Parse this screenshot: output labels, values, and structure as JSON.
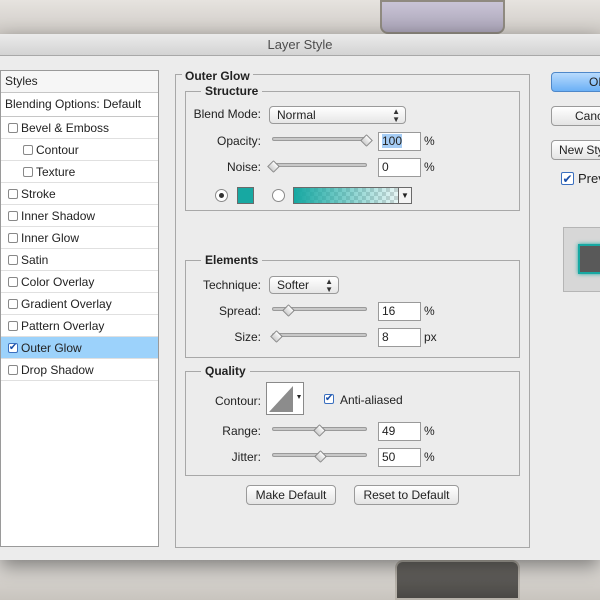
{
  "window": {
    "title": "Layer Style"
  },
  "styles_panel": {
    "header": "Styles",
    "blending_options": "Blending Options: Default",
    "items": [
      {
        "label": "Bevel & Emboss",
        "checked": false,
        "sub": false
      },
      {
        "label": "Contour",
        "checked": false,
        "sub": true
      },
      {
        "label": "Texture",
        "checked": false,
        "sub": true
      },
      {
        "label": "Stroke",
        "checked": false,
        "sub": false
      },
      {
        "label": "Inner Shadow",
        "checked": false,
        "sub": false
      },
      {
        "label": "Inner Glow",
        "checked": false,
        "sub": false
      },
      {
        "label": "Satin",
        "checked": false,
        "sub": false
      },
      {
        "label": "Color Overlay",
        "checked": false,
        "sub": false
      },
      {
        "label": "Gradient Overlay",
        "checked": false,
        "sub": false
      },
      {
        "label": "Pattern Overlay",
        "checked": false,
        "sub": false
      },
      {
        "label": "Outer Glow",
        "checked": true,
        "sub": false,
        "selected": true
      },
      {
        "label": "Drop Shadow",
        "checked": false,
        "sub": false
      }
    ]
  },
  "outer_glow": {
    "title": "Outer Glow",
    "structure": {
      "title": "Structure",
      "blend_mode_label": "Blend Mode:",
      "blend_mode_value": "Normal",
      "opacity_label": "Opacity:",
      "opacity_value": "100",
      "opacity_pct": 100,
      "opacity_unit": "%",
      "noise_label": "Noise:",
      "noise_value": "0",
      "noise_pct": 0,
      "noise_unit": "%",
      "glow_color": "#17a8a2"
    },
    "elements": {
      "title": "Elements",
      "technique_label": "Technique:",
      "technique_value": "Softer",
      "spread_label": "Spread:",
      "spread_value": "16",
      "spread_pct": 16,
      "spread_unit": "%",
      "size_label": "Size:",
      "size_value": "8",
      "size_fraction": 0.032,
      "size_unit": "px"
    },
    "quality": {
      "title": "Quality",
      "contour_label": "Contour:",
      "anti_aliased_label": "Anti-aliased",
      "anti_aliased_checked": true,
      "range_label": "Range:",
      "range_value": "49",
      "range_pct": 49,
      "range_unit": "%",
      "jitter_label": "Jitter:",
      "jitter_value": "50",
      "jitter_pct": 50,
      "jitter_unit": "%"
    },
    "make_default_label": "Make Default",
    "reset_default_label": "Reset to Default"
  },
  "right_buttons": {
    "ok_label": "OK",
    "cancel_label": "Cancel",
    "new_style_label": "New Style...",
    "preview_label": "Preview",
    "preview_checked": true
  },
  "check_glyph": "✔"
}
